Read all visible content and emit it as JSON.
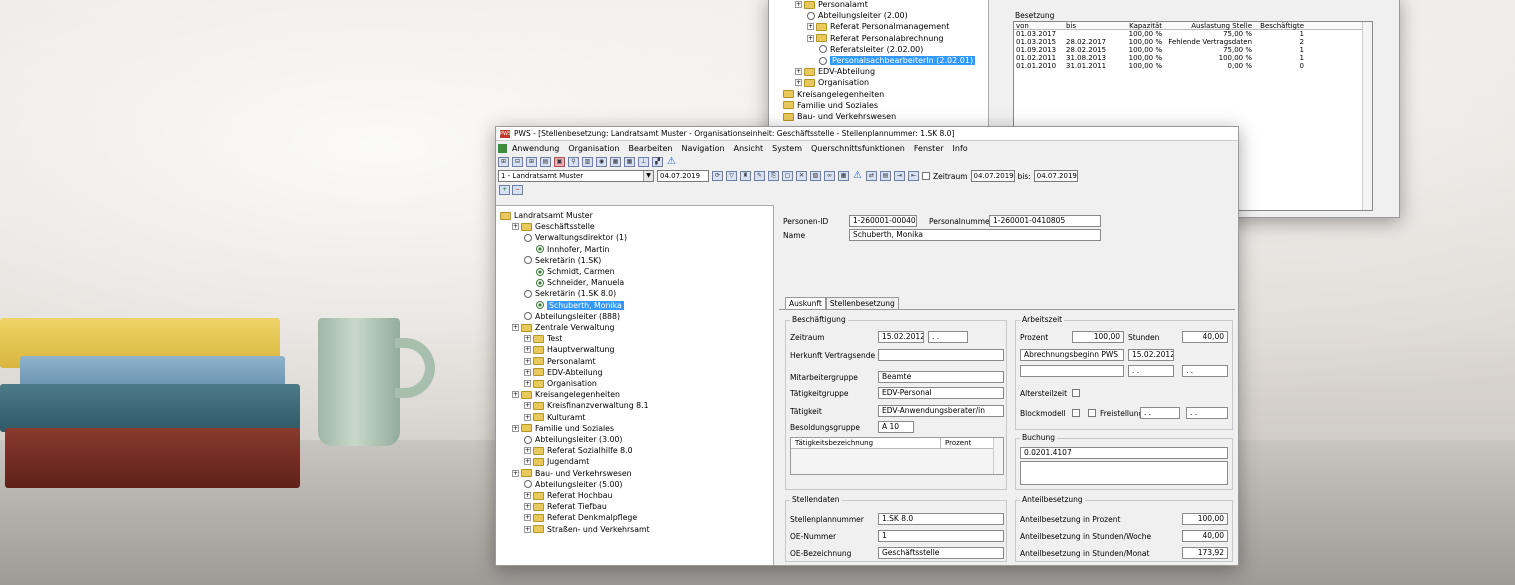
{
  "back_window": {
    "tree": [
      {
        "label": "Personalamt",
        "kind": "folder",
        "indent": 1
      },
      {
        "label": "Abteilungsleiter (2.00)",
        "kind": "circle",
        "indent": 2
      },
      {
        "label": "Referat Personalmanagement",
        "kind": "folder",
        "indent": 2
      },
      {
        "label": "Referat Personalabrechnung",
        "kind": "folder",
        "indent": 2
      },
      {
        "label": "Referatsleiter (2.02.00)",
        "kind": "circle",
        "indent": 3
      },
      {
        "label": "PersonalsachbearbeiterIn (2.02.01)",
        "kind": "circle-selected",
        "indent": 3
      },
      {
        "label": "EDV-Abteilung",
        "kind": "folder",
        "indent": 1
      },
      {
        "label": "Organisation",
        "kind": "folder",
        "indent": 1
      },
      {
        "label": "Kreisangelegenheiten",
        "kind": "folder",
        "indent": 0
      },
      {
        "label": "Familie und Soziales",
        "kind": "folder",
        "indent": 0
      },
      {
        "label": "Bau- und Verkehrswesen",
        "kind": "folder",
        "indent": 0
      }
    ],
    "besetzung_title": "Besetzung",
    "columns": [
      "von",
      "bis",
      "Kapazität",
      "Auslastung Stelle",
      "Beschäftigte"
    ],
    "rows": [
      [
        "01.03.2017",
        "",
        "100,00 %",
        "75,00 %",
        "1"
      ],
      [
        "01.03.2015",
        "28.02.2017",
        "100,00 %",
        "Fehlende Vertragsdaten",
        "2"
      ],
      [
        "01.09.2013",
        "28.02.2015",
        "100,00 %",
        "75,00 %",
        "1"
      ],
      [
        "01.02.2011",
        "31.08.2013",
        "100,00 %",
        "100,00 %",
        "1"
      ],
      [
        "01.01.2010",
        "31.01.2011",
        "100,00 %",
        "0,00 %",
        "0"
      ]
    ]
  },
  "window_title": "PWS - [Stellenbesetzung: Landratsamt Muster - Organisationseinheit: Geschäftsstelle - Stellenplannummer: 1.SK 8.0]",
  "app_icon": "PWS",
  "menu": [
    "Anwendung",
    "Organisation",
    "Bearbeiten",
    "Navigation",
    "Ansicht",
    "System",
    "Querschnittsfunktionen",
    "Fenster",
    "Info"
  ],
  "toolbar": {
    "org_combo": "1 - Landratsamt Muster",
    "date_combo": "04.07.2019",
    "zeitraum_label": "Zeitraum",
    "zeitraum_from": "04.07.2019",
    "bis_label": "bis:",
    "zeitraum_to": "04.07.2019"
  },
  "tree_buttons": [
    "+",
    "−"
  ],
  "tree": [
    {
      "label": "Landratsamt Muster",
      "kind": "folder",
      "indent": 0
    },
    {
      "label": "Geschäftsstelle",
      "kind": "folder",
      "indent": 1
    },
    {
      "label": "Verwaltungsdirektor (1)",
      "kind": "circle",
      "indent": 2
    },
    {
      "label": "Innhofer, Martin",
      "kind": "person",
      "indent": 3
    },
    {
      "label": "Sekretärin (1.SK)",
      "kind": "circle",
      "indent": 2
    },
    {
      "label": "Schmidt, Carmen",
      "kind": "person",
      "indent": 3
    },
    {
      "label": "Schneider, Manuela",
      "kind": "person",
      "indent": 3
    },
    {
      "label": "Sekretärin (1.SK 8.0)",
      "kind": "circle",
      "indent": 2
    },
    {
      "label": "Schuberth, Monika",
      "kind": "person-selected",
      "indent": 3
    },
    {
      "label": "Abteilungsleiter (888)",
      "kind": "circle",
      "indent": 2
    },
    {
      "label": "Zentrale Verwaltung",
      "kind": "folder",
      "indent": 1
    },
    {
      "label": "Test",
      "kind": "folder",
      "indent": 2
    },
    {
      "label": "Hauptverwaltung",
      "kind": "folder",
      "indent": 2
    },
    {
      "label": "Personalamt",
      "kind": "folder",
      "indent": 2
    },
    {
      "label": "EDV-Abteilung",
      "kind": "folder",
      "indent": 2
    },
    {
      "label": "Organisation",
      "kind": "folder",
      "indent": 2
    },
    {
      "label": "Kreisangelegenheiten",
      "kind": "folder",
      "indent": 1
    },
    {
      "label": "Kreisfinanzverwaltung 8.1",
      "kind": "folder",
      "indent": 2
    },
    {
      "label": "Kulturamt",
      "kind": "folder",
      "indent": 2
    },
    {
      "label": "Familie und Soziales",
      "kind": "folder",
      "indent": 1
    },
    {
      "label": "Abteilungsleiter (3.00)",
      "kind": "circle",
      "indent": 2
    },
    {
      "label": "Referat Sozialhilfe 8.0",
      "kind": "folder",
      "indent": 2
    },
    {
      "label": "Jugendamt",
      "kind": "folder",
      "indent": 2
    },
    {
      "label": "Bau- und Verkehrswesen",
      "kind": "folder",
      "indent": 1
    },
    {
      "label": "Abteilungsleiter (5.00)",
      "kind": "circle",
      "indent": 2
    },
    {
      "label": "Referat Hochbau",
      "kind": "folder",
      "indent": 2
    },
    {
      "label": "Referat Tiefbau",
      "kind": "folder",
      "indent": 2
    },
    {
      "label": "Referat Denkmalpflege",
      "kind": "folder",
      "indent": 2
    },
    {
      "label": "Straßen- und Verkehrsamt",
      "kind": "folder",
      "indent": 2
    }
  ],
  "person": {
    "id_label": "Personen-ID",
    "id_value": "1-260001-00040",
    "nr_label": "Personalnummer",
    "nr_value": "1-260001-0410805",
    "name_label": "Name",
    "name_value": "Schuberth, Monika"
  },
  "tabs": [
    "Auskunft",
    "Stellenbesetzung"
  ],
  "beschaeftigung": {
    "title": "Beschäftigung",
    "zeitraum_label": "Zeitraum",
    "zeitraum_from": "15.02.2012",
    "zeitraum_to": " . .",
    "herkunft_label": "Herkunft Vertragsende",
    "herkunft_value": "",
    "mitarbeitergruppe_label": "Mitarbeitergruppe",
    "mitarbeitergruppe_value": "Beamte",
    "taetigkeitgruppe_label": "Tätigkeitgruppe",
    "taetigkeitgruppe_value": "EDV-Personal",
    "taetigkeit_label": "Tätigkeit",
    "taetigkeit_value": "EDV-Anwendungsberater/in",
    "besoldung_label": "Besoldungsgruppe",
    "besoldung_value": "A 10",
    "grid_col1": "Tätigkeitsbezeichnung",
    "grid_col2": "Prozent"
  },
  "arbeitszeit": {
    "title": "Arbeitszeit",
    "prozent_label": "Prozent",
    "prozent_value": "100,00",
    "stunden_label": "Stunden",
    "stunden_value": "40,00",
    "abrechnung_value": "Abrechnungsbeginn PWS",
    "abrechnung_date": "15.02.2012",
    "empty_date_1": " . .",
    "empty_date_2": " . .",
    "altersteilzeit_label": "Altersteilzeit",
    "blockmodell_label": "Blockmodell",
    "freistellung_label": "Freistellung",
    "freistellung_from": " . .",
    "freistellung_to": " . ."
  },
  "buchung": {
    "title": "Buchung",
    "value": "0.0201.4107"
  },
  "stellendaten": {
    "title": "Stellendaten",
    "plannummer_label": "Stellenplannummer",
    "plannummer_value": "1.SK 8.0",
    "oe_nr_label": "OE-Nummer",
    "oe_nr_value": "1",
    "oe_bez_label": "OE-Bezeichnung",
    "oe_bez_value": "Geschäftsstelle"
  },
  "anteilbesetzung": {
    "title": "Anteilbesetzung",
    "prozent_label": "Anteilbesetzung in Prozent",
    "prozent_value": "100,00",
    "woche_label": "Anteilbesetzung in Stunden/Woche",
    "woche_value": "40,00",
    "monat_label": "Anteilbesetzung in Stunden/Monat",
    "monat_value": "173,92"
  }
}
